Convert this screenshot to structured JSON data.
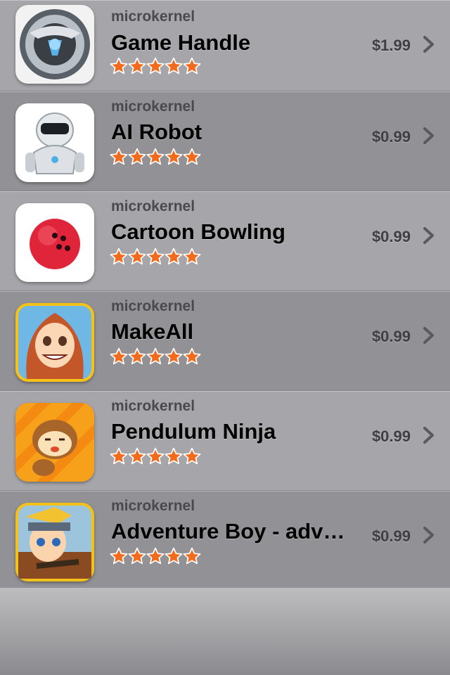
{
  "apps": [
    {
      "developer": "microkernel",
      "title": "Game Handle",
      "price": "$1.99",
      "rating": 5,
      "icon": "game-handle-icon"
    },
    {
      "developer": "microkernel",
      "title": "AI Robot",
      "price": "$0.99",
      "rating": 5,
      "icon": "robot-icon"
    },
    {
      "developer": "microkernel",
      "title": "Cartoon Bowling",
      "price": "$0.99",
      "rating": 5,
      "icon": "bowling-ball-icon"
    },
    {
      "developer": "microkernel",
      "title": "MakeAll",
      "price": "$0.99",
      "rating": 5,
      "icon": "cartoon-girl-icon"
    },
    {
      "developer": "microkernel",
      "title": "Pendulum Ninja",
      "price": "$0.99",
      "rating": 5,
      "icon": "monkey-icon"
    },
    {
      "developer": "microkernel",
      "title": "Adventure Boy - adventure",
      "price": "$0.99",
      "rating": 5,
      "icon": "ninja-boy-icon"
    }
  ],
  "colors": {
    "star": "#f26a1b",
    "row_light": "#a6a6aa",
    "row_dark": "#929296"
  }
}
